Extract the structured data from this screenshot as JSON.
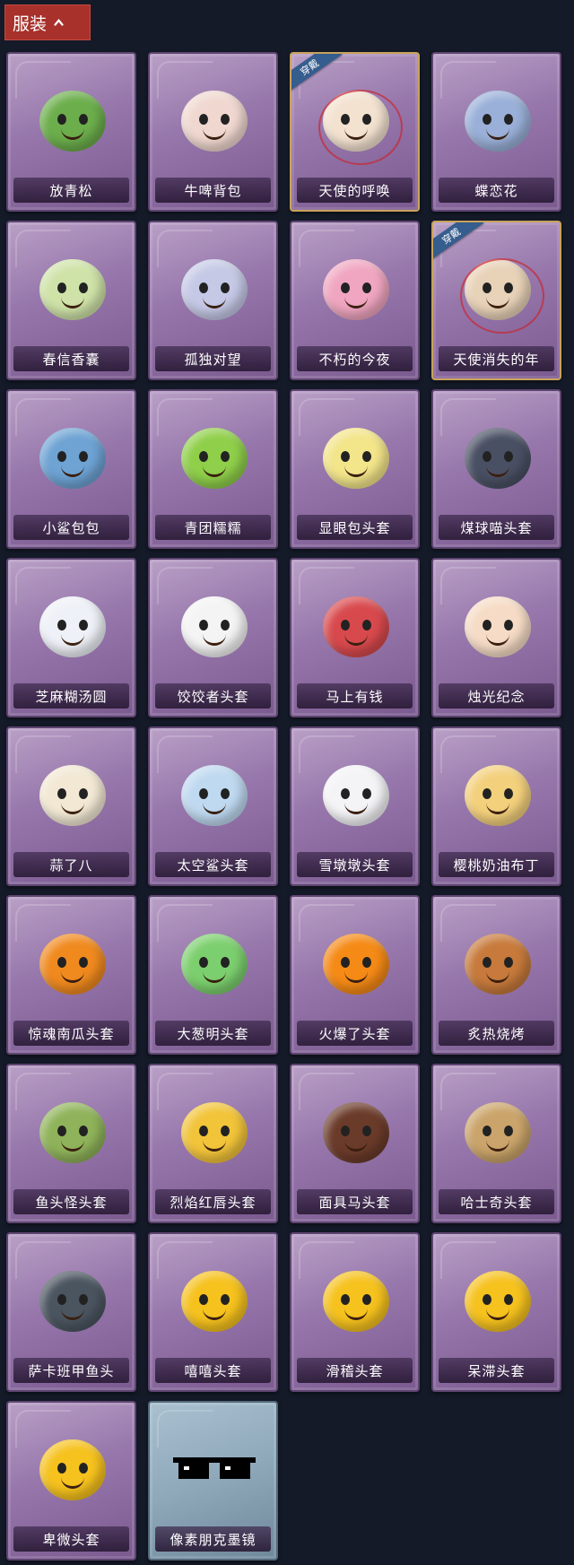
{
  "header": {
    "label": "服装",
    "icon": "chevron-up-icon"
  },
  "badge_text": "穿戴",
  "items": [
    {
      "name": "放青松",
      "icon": "pine-bonsai-icon",
      "color": "#6cae4c"
    },
    {
      "name": "牛啤背包",
      "icon": "cow-beer-barrel-icon",
      "color": "#f0d8d0"
    },
    {
      "name": "天使的呼唤",
      "icon": "angel-doll-icon",
      "color": "#f3e2d0",
      "worn": true
    },
    {
      "name": "蝶恋花",
      "icon": "butterfly-bell-icon",
      "color": "#9ab0d8"
    },
    {
      "name": "春信香囊",
      "icon": "sachet-icon",
      "color": "#cfe3a8"
    },
    {
      "name": "孤独对望",
      "icon": "keychain-doll-icon",
      "color": "#c6c9e6"
    },
    {
      "name": "不朽的今夜",
      "icon": "pink-fox-bowl-icon",
      "color": "#f0a6c0"
    },
    {
      "name": "天使消失的年",
      "icon": "veiled-doll-icon",
      "color": "#e8d2b8",
      "worn": true
    },
    {
      "name": "小鲨包包",
      "icon": "shark-bag-icon",
      "color": "#6ea3d4"
    },
    {
      "name": "青团糯糯",
      "icon": "green-rice-ball-icon",
      "color": "#8fcf4a"
    },
    {
      "name": "显眼包头套",
      "icon": "lightbulb-head-icon",
      "color": "#f3e58a"
    },
    {
      "name": "煤球喵头套",
      "icon": "black-cat-head-icon",
      "color": "#4a5064"
    },
    {
      "name": "芝麻糊汤圆",
      "icon": "rice-dumpling-icon",
      "color": "#eef1f7"
    },
    {
      "name": "饺饺者头套",
      "icon": "dumpling-cloud-icon",
      "color": "#f4f4f4"
    },
    {
      "name": "马上有钱",
      "icon": "red-horse-icon",
      "color": "#d8494d"
    },
    {
      "name": "烛光纪念",
      "icon": "candle-head-icon",
      "color": "#f6dcc6"
    },
    {
      "name": "蒜了八",
      "icon": "garlic-head-icon",
      "color": "#f2e8d4"
    },
    {
      "name": "太空鲨头套",
      "icon": "space-shark-icon",
      "color": "#bfd9f0"
    },
    {
      "name": "雪墩墩头套",
      "icon": "snowman-head-icon",
      "color": "#f4f4f7"
    },
    {
      "name": "樱桃奶油布丁",
      "icon": "pudding-head-icon",
      "color": "#f3d07c"
    },
    {
      "name": "惊魂南瓜头套",
      "icon": "pumpkin-head-icon",
      "color": "#f08a1f"
    },
    {
      "name": "大葱明头套",
      "icon": "green-onion-head-icon",
      "color": "#7ccf6e"
    },
    {
      "name": "火爆了头套",
      "icon": "fire-head-icon",
      "color": "#f58a16"
    },
    {
      "name": "炙热烧烤",
      "icon": "bbq-meat-icon",
      "color": "#c77a3b"
    },
    {
      "name": "鱼头怪头套",
      "icon": "fish-head-mask-icon",
      "color": "#8fb35a"
    },
    {
      "name": "烈焰红唇头套",
      "icon": "yellow-mask-sunglasses-icon",
      "color": "#f2c43a"
    },
    {
      "name": "面具马头套",
      "icon": "horse-mask-icon",
      "color": "#6b3b2a"
    },
    {
      "name": "哈士奇头套",
      "icon": "dog-sunglasses-icon",
      "color": "#caa46a"
    },
    {
      "name": "萨卡班甲鱼头",
      "icon": "sacabambaspis-icon",
      "color": "#4b5560"
    },
    {
      "name": "嘻嘻头套",
      "icon": "grin-emoji-icon",
      "color": "#f6c21e"
    },
    {
      "name": "滑稽头套",
      "icon": "smirk-emoji-icon",
      "color": "#f6c21e"
    },
    {
      "name": "呆滞头套",
      "icon": "stare-emoji-icon",
      "color": "#f6c21e"
    },
    {
      "name": "卑微头套",
      "icon": "humble-emoji-icon",
      "color": "#f6c21e"
    },
    {
      "name": "像素朋克墨镜",
      "icon": "pixel-sunglasses-icon",
      "color": "#111111",
      "variant": "blue"
    }
  ]
}
